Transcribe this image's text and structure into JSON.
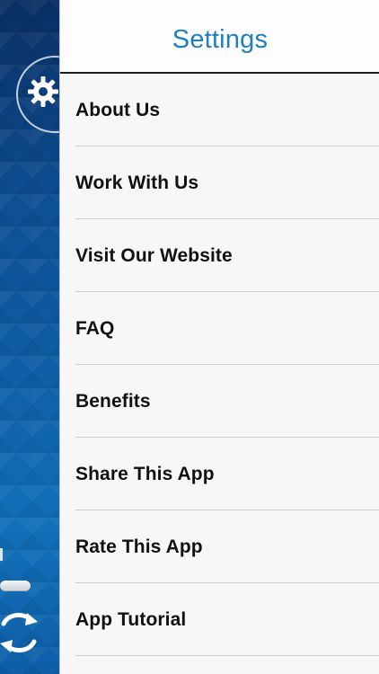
{
  "header": {
    "title": "Settings"
  },
  "menu": {
    "items": [
      {
        "label": "About Us"
      },
      {
        "label": "Work With Us"
      },
      {
        "label": "Visit Our Website"
      },
      {
        "label": "FAQ"
      },
      {
        "label": "Benefits"
      },
      {
        "label": "Share This App"
      },
      {
        "label": "Rate This App"
      },
      {
        "label": "App Tutorial"
      }
    ]
  },
  "icons": {
    "settings": "gear-icon",
    "sync": "sync-icon"
  },
  "colors": {
    "accent": "#1f7fbf",
    "background_blue": "#0d4f93",
    "panel_bg": "#f7f7f7",
    "item_text": "#111111",
    "divider": "#cfcfcf"
  }
}
